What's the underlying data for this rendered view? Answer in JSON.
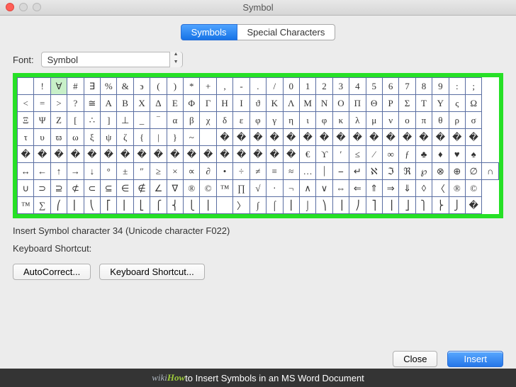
{
  "window": {
    "title": "Symbol"
  },
  "tabs": {
    "symbols": "Symbols",
    "special": "Special Characters"
  },
  "font": {
    "label": "Font:",
    "value": "Symbol"
  },
  "grid": {
    "selected_row": 0,
    "selected_col": 2,
    "rows": [
      [
        "",
        "!",
        "∀",
        "#",
        "∃",
        "%",
        "&",
        "϶",
        "(",
        ")",
        "*",
        "+",
        ",",
        "-",
        ".",
        "/",
        "0",
        "1",
        "2",
        "3",
        "4",
        "5",
        "6",
        "7",
        "8",
        "9",
        ":",
        ";"
      ],
      [
        "<",
        "=",
        ">",
        "?",
        "≅",
        "Α",
        "Β",
        "Χ",
        "Δ",
        "Ε",
        "Φ",
        "Γ",
        "Η",
        "Ι",
        "ϑ",
        "Κ",
        "Λ",
        "Μ",
        "Ν",
        "Ο",
        "Π",
        "Θ",
        "Ρ",
        "Σ",
        "Τ",
        "Υ",
        "ς",
        "Ω"
      ],
      [
        "Ξ",
        "Ψ",
        "Ζ",
        "[",
        "∴",
        "]",
        "⊥",
        "_",
        "‾",
        "α",
        "β",
        "χ",
        "δ",
        "ε",
        "φ",
        "γ",
        "η",
        "ι",
        "φ",
        "κ",
        "λ",
        "μ",
        "ν",
        "ο",
        "π",
        "θ",
        "ρ",
        "σ"
      ],
      [
        "τ",
        "υ",
        "ϖ",
        "ω",
        "ξ",
        "ψ",
        "ζ",
        "{",
        "|",
        "}",
        "~",
        "",
        "�",
        "�",
        "�",
        "�",
        "�",
        "�",
        "�",
        "�",
        "�",
        "�",
        "�",
        "�",
        "�",
        "�",
        "�",
        "�"
      ],
      [
        "�",
        "�",
        "�",
        "�",
        "�",
        "�",
        "�",
        "�",
        "�",
        "�",
        "�",
        "�",
        "�",
        "�",
        "�",
        "�",
        "�",
        "€",
        "ϒ",
        "′",
        "≤",
        "⁄",
        "∞",
        "ƒ",
        "♣",
        "♦",
        "♥",
        "♠"
      ],
      [
        "↔",
        "←",
        "↑",
        "→",
        "↓",
        "°",
        "±",
        "″",
        "≥",
        "×",
        "∝",
        "∂",
        "•",
        "÷",
        "≠",
        "≡",
        "≈",
        "…",
        "⏐",
        "⎯",
        "↵",
        "ℵ",
        "ℑ",
        "ℜ",
        "℘",
        "⊗",
        "⊕",
        "∅",
        "∩"
      ],
      [
        "∪",
        "⊃",
        "⊇",
        "⊄",
        "⊂",
        "⊆",
        "∈",
        "∉",
        "∠",
        "∇",
        "®",
        "©",
        "™",
        "∏",
        "√",
        "⋅",
        "¬",
        "∧",
        "∨",
        "⇔",
        "⇐",
        "⇑",
        "⇒",
        "⇓",
        "◊",
        "〈",
        "®",
        "©"
      ],
      [
        "™",
        "∑",
        "⎛",
        "⎜",
        "⎝",
        "⎡",
        "⎢",
        "⎣",
        "⎧",
        "⎨",
        "⎩",
        "⎪",
        "",
        "〉",
        "∫",
        "⌠",
        "⎮",
        "⌡",
        "⎞",
        "⎟",
        "⎠",
        "⎤",
        "⎥",
        "⎦",
        "⎫",
        "⎬",
        "⎭",
        "�"
      ]
    ]
  },
  "info": {
    "selection_text": "Insert Symbol character 34  (Unicode character F022)",
    "shortcut_label": "Keyboard Shortcut:"
  },
  "buttons": {
    "autocorrect": "AutoCorrect...",
    "keyboard_shortcut": "Keyboard Shortcut...",
    "close": "Close",
    "insert": "Insert"
  },
  "caption": {
    "prefix_wiki": "wiki",
    "prefix_how": "How",
    "text": " to Insert Symbols in an MS Word Document"
  }
}
